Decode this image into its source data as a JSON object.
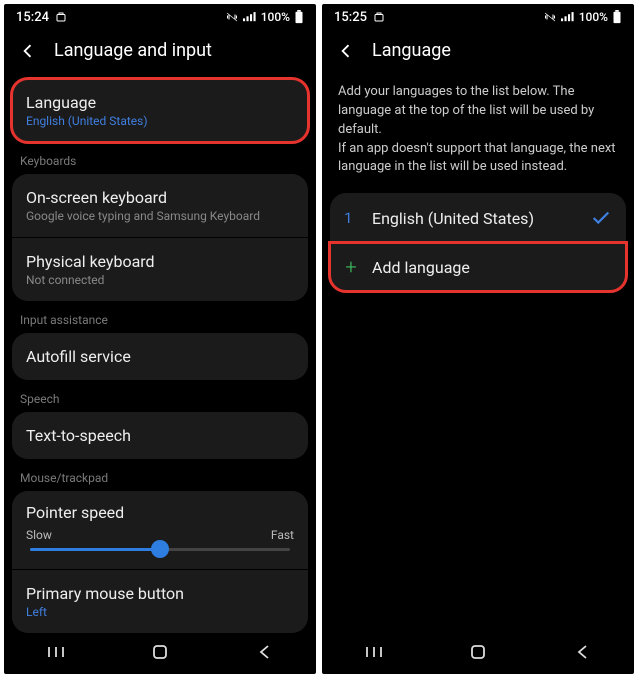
{
  "left": {
    "status": {
      "time": "15:24",
      "battery": "100%"
    },
    "header": {
      "title": "Language and input"
    },
    "language": {
      "title": "Language",
      "subtitle": "English (United States)"
    },
    "sections": {
      "keyboards": "Keyboards",
      "input_assistance": "Input assistance",
      "speech": "Speech",
      "mouse": "Mouse/trackpad"
    },
    "rows": {
      "onscreen_kb": {
        "title": "On-screen keyboard",
        "subtitle": "Google voice typing and Samsung Keyboard"
      },
      "physical_kb": {
        "title": "Physical keyboard",
        "subtitle": "Not connected"
      },
      "autofill": {
        "title": "Autofill service"
      },
      "tts": {
        "title": "Text-to-speech"
      },
      "pointer": {
        "title": "Pointer speed",
        "slow": "Slow",
        "fast": "Fast"
      },
      "primary_mouse": {
        "title": "Primary mouse button",
        "subtitle": "Left"
      }
    }
  },
  "right": {
    "status": {
      "time": "15:25",
      "battery": "100%"
    },
    "header": {
      "title": "Language"
    },
    "description": "Add your languages to the list below. The language at the top of the list will be used by default.\nIf an app doesn't support that language, the next language in the list will be used instead.",
    "lang1": {
      "num": "1",
      "name": "English (United States)"
    },
    "add": {
      "label": "Add language"
    }
  }
}
